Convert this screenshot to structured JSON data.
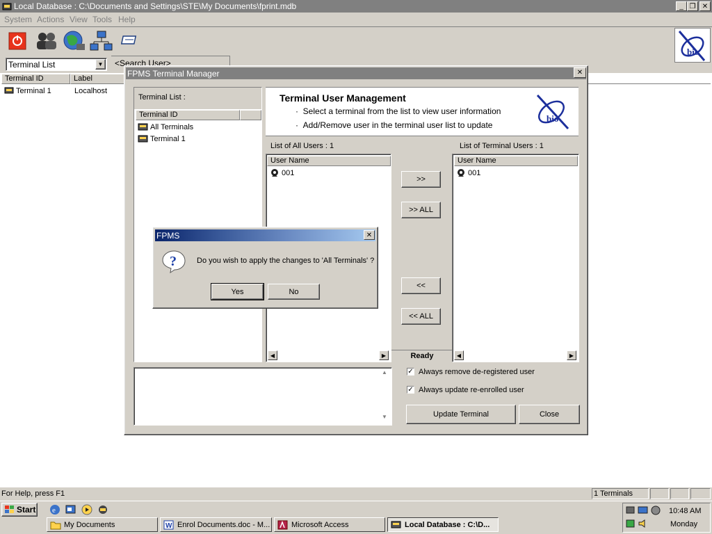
{
  "main_window": {
    "title": "Local Database : C:\\Documents and Settings\\STE\\My Documents\\fprint.mdb",
    "menu": [
      "System",
      "Actions",
      "View",
      "Tools",
      "Help"
    ],
    "toolbar_icons": [
      "power-icon",
      "users-icon",
      "globe-icon",
      "network-icon",
      "card-icon"
    ],
    "view_select": "Terminal List",
    "search_placeholder": "<Search User>",
    "columns": [
      "Terminal ID",
      "Label"
    ],
    "rows": [
      {
        "id": "Terminal 1",
        "label": "Localhost"
      }
    ],
    "status_help": "For Help, press F1",
    "status_terminals": "1 Terminals",
    "logo_text": "bio"
  },
  "manager": {
    "title": "FPMS Terminal Manager",
    "terminal_list_label": "Terminal List :",
    "terminal_column": "Terminal ID",
    "terminals": [
      "All Terminals",
      "Terminal 1"
    ],
    "heading": "Terminal User Management",
    "bullets": [
      "Select a terminal from the list to view user information",
      "Add/Remove user in the terminal user list to update"
    ],
    "logo_text": "bio",
    "all_users_label": "List of All Users : 1",
    "terminal_users_label": "List of Terminal Users : 1",
    "user_name_column": "User Name",
    "all_users": [
      "001"
    ],
    "terminal_users": [
      "001"
    ],
    "btn_add": ">>",
    "btn_add_all": ">> ALL",
    "btn_remove": "<<",
    "btn_remove_all": "<< ALL",
    "status": "Ready",
    "chk_remove": "Always remove de-registered user",
    "chk_update": "Always update re-enrolled user",
    "btn_update": "Update Terminal",
    "btn_close": "Close"
  },
  "dialog": {
    "title": "FPMS",
    "message": "Do you wish to apply the changes to 'All Terminals' ?",
    "yes": "Yes",
    "no": "No"
  },
  "taskbar": {
    "start": "Start",
    "tasks": [
      "My Documents",
      "Enrol Documents.doc - M...",
      "Microsoft Access",
      "Local Database : C:\\D..."
    ],
    "time": "10:48 AM",
    "day": "Monday"
  }
}
